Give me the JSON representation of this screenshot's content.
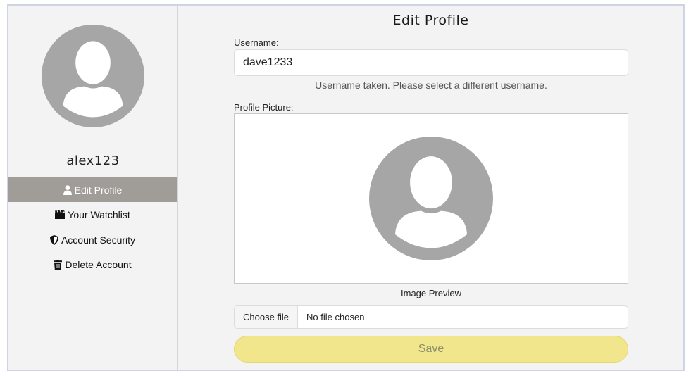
{
  "user": {
    "username": "alex123"
  },
  "sidebar": {
    "items": [
      {
        "label": "Edit Profile",
        "icon": "user-icon",
        "active": true
      },
      {
        "label": "Your Watchlist",
        "icon": "clapperboard-icon",
        "active": false
      },
      {
        "label": "Account Security",
        "icon": "shield-icon",
        "active": false
      },
      {
        "label": "Delete Account",
        "icon": "trash-icon",
        "active": false
      }
    ]
  },
  "form": {
    "title": "Edit Profile",
    "username_label": "Username:",
    "username_value": "dave1233",
    "username_feedback": "Username taken. Please select a different username.",
    "picture_label": "Profile Picture:",
    "preview_caption": "Image Preview",
    "file_button_label": "Choose file",
    "file_status": "No file chosen",
    "save_label": "Save"
  },
  "colors": {
    "sidebar_active_bg": "#a09d98",
    "avatar_gray": "#a6a6a6",
    "save_bg": "#f2e68c",
    "frame_border": "#cfd3e6"
  }
}
